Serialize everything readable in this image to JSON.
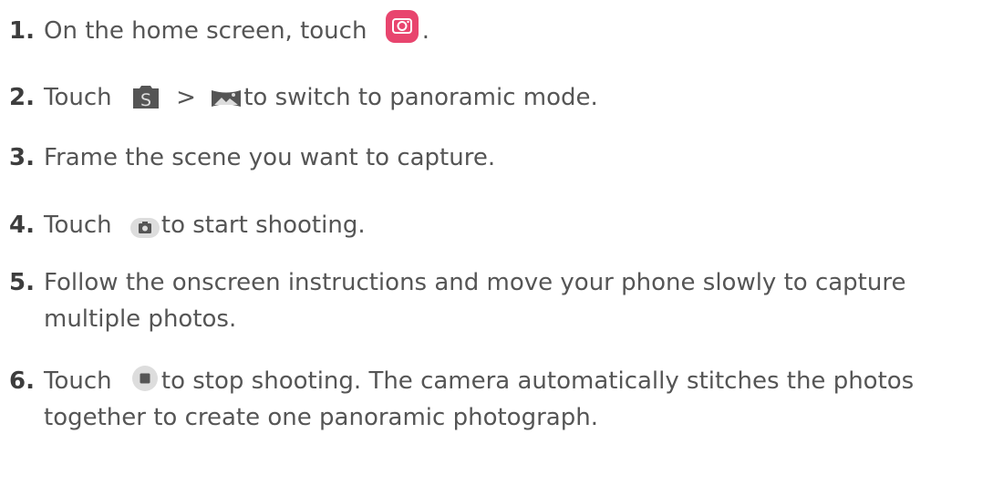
{
  "steps": [
    {
      "number": "1.",
      "before": "On the home screen, touch",
      "icon": "camera-app-icon",
      "after": "."
    },
    {
      "number": "2.",
      "before": "Touch",
      "icon": "camera-modes-icon",
      "separator": ">",
      "icon2": "panorama-mode-icon",
      "after": "to switch to panoramic mode."
    },
    {
      "number": "3.",
      "text": "Frame the scene you want to capture."
    },
    {
      "number": "4.",
      "before": "Touch",
      "icon": "shutter-button-icon",
      "after": "to start shooting."
    },
    {
      "number": "5.",
      "text": "Follow the onscreen instructions and move your phone slowly to capture multiple photos."
    },
    {
      "number": "6.",
      "before": "Touch",
      "icon": "stop-button-icon",
      "after": "to stop shooting. The camera automatically stitches the photos together to create one panoramic photograph."
    }
  ],
  "colors": {
    "camera_app": "#e8456e",
    "dark_icon": "#555555",
    "light_icon": "#dddddd"
  }
}
